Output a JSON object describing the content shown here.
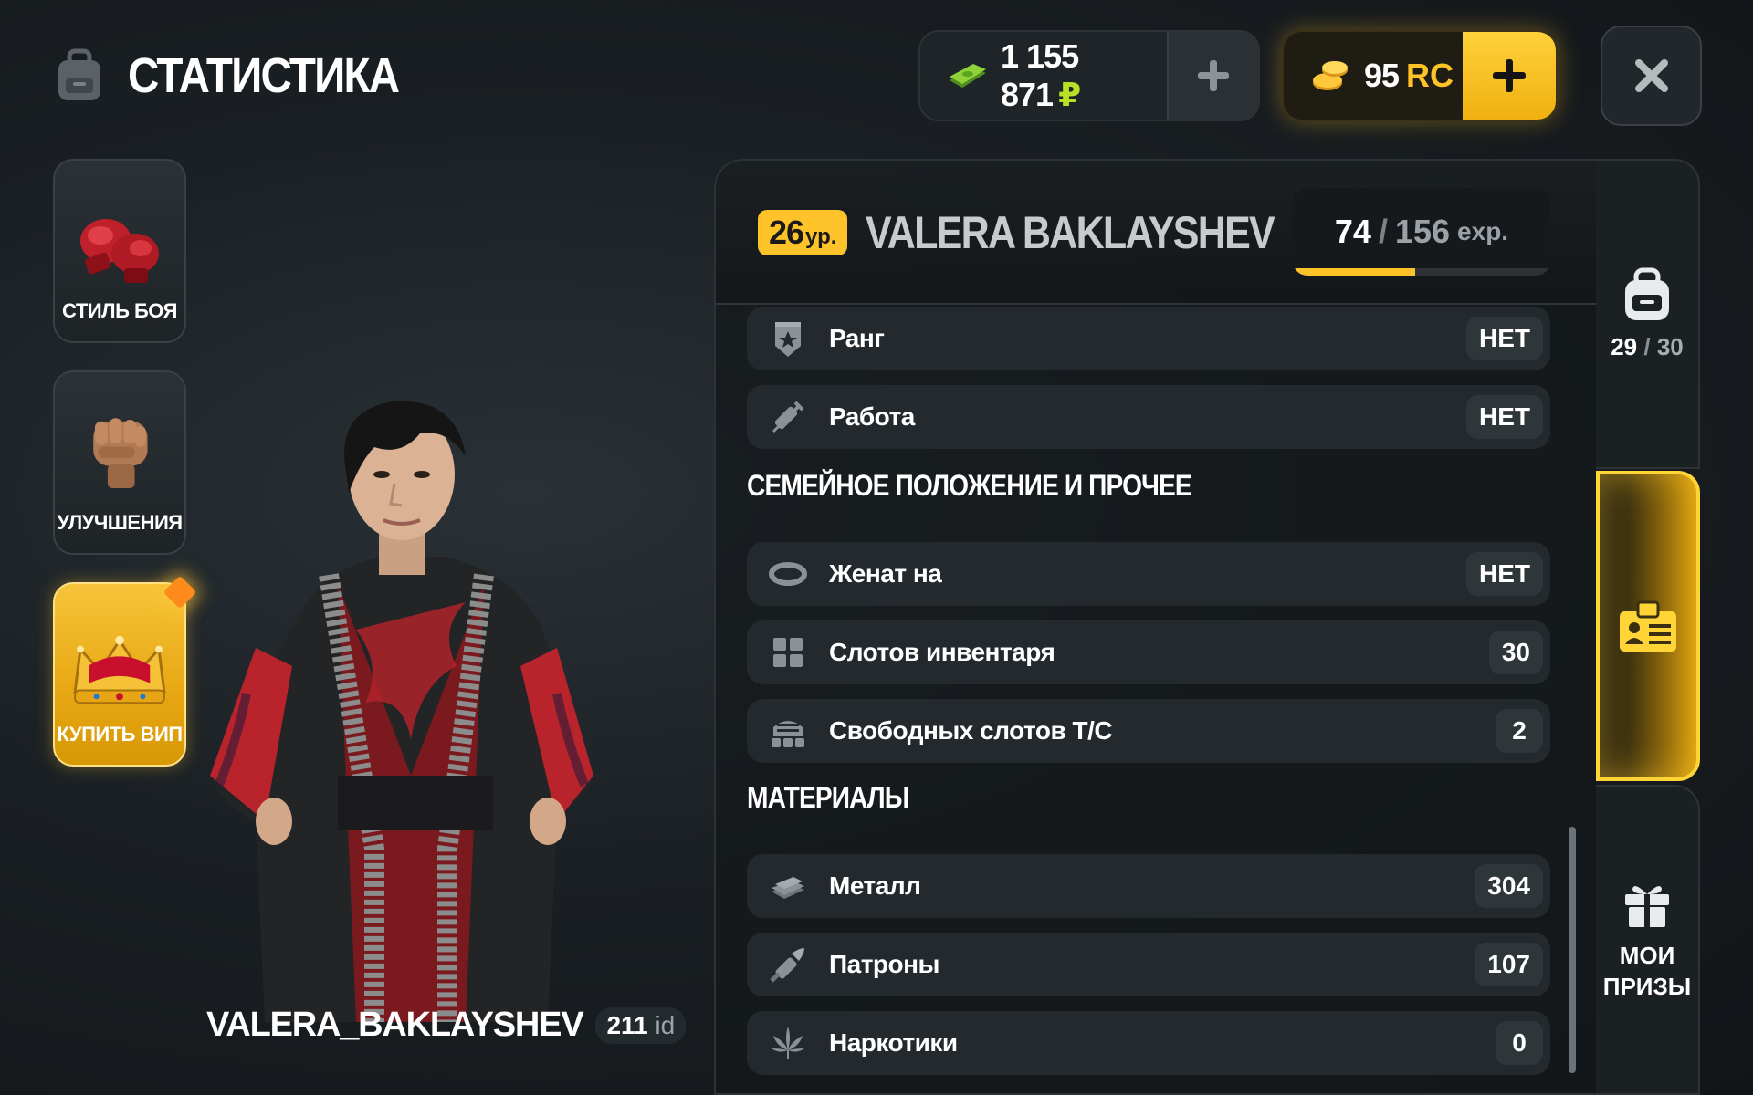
{
  "header": {
    "title": "СТАТИСТИКА",
    "money": {
      "value": "1 155 871",
      "currency": "₽"
    },
    "rc": {
      "value": "95",
      "label": "RC"
    }
  },
  "sidebar": {
    "items": [
      {
        "label": "СТИЛЬ БОЯ",
        "icon": "boxing-gloves-icon"
      },
      {
        "label": "УЛУЧШЕНИЯ",
        "icon": "fist-icon"
      },
      {
        "label": "КУПИТЬ ВИП",
        "icon": "crown-icon"
      }
    ]
  },
  "player": {
    "nickname": "VALERA_BAKLAYSHEV",
    "id_value": "211",
    "id_unit": "id"
  },
  "profile": {
    "level": "26",
    "level_unit": "ур.",
    "name": "VALERA BAKLAYSHEV",
    "exp_current": "74",
    "exp_separator": "/",
    "exp_max": "156",
    "exp_unit": "exp.",
    "exp_fraction": 0.474
  },
  "stats": {
    "rows_top": [
      {
        "label": "Ранг",
        "value": "НЕТ",
        "icon": "rank-badge-icon"
      },
      {
        "label": "Работа",
        "value": "НЕТ",
        "icon": "syringe-icon"
      }
    ],
    "family_heading": "СЕМЕЙНОЕ ПОЛОЖЕНИЕ И ПРОЧЕЕ",
    "family_rows": [
      {
        "label": "Женат на",
        "value": "НЕТ",
        "icon": "ring-icon"
      },
      {
        "label": "Слотов инвентаря",
        "value": "30",
        "icon": "grid-icon"
      },
      {
        "label": "Свободных слотов Т/С",
        "value": "2",
        "icon": "garage-icon"
      }
    ],
    "materials_heading": "МАТЕРИАЛЫ",
    "materials_rows": [
      {
        "label": "Металл",
        "value": "304",
        "icon": "metal-ingot-icon"
      },
      {
        "label": "Патроны",
        "value": "107",
        "icon": "bullet-icon"
      },
      {
        "label": "Наркотики",
        "value": "0",
        "icon": "leaf-icon"
      }
    ]
  },
  "right_tabs": {
    "inventory": {
      "current": "29",
      "separator": "/",
      "max": "30",
      "icon": "backpack-icon"
    },
    "stats": {
      "icon": "id-card-icon"
    },
    "prizes": {
      "label_line1": "МОИ",
      "label_line2": "ПРИЗЫ",
      "icon": "gift-icon"
    }
  },
  "colors": {
    "accent_yellow": "#ffc32a",
    "money_green": "#b8e026",
    "rc_gold": "#ffc328"
  }
}
